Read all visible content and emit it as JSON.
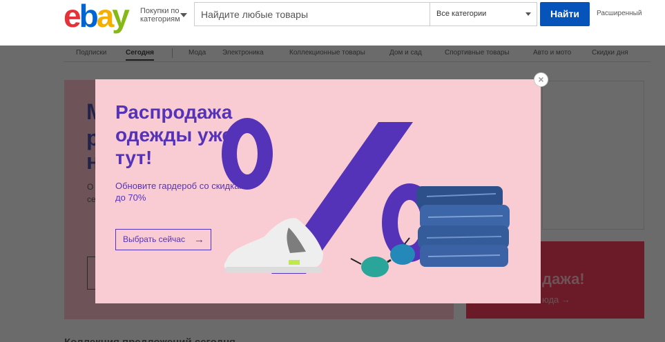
{
  "header": {
    "logo_text": "ebay",
    "shop_by_line1": "Покупки по",
    "shop_by_line2": "категориям",
    "search_placeholder": "Найдите любые товары",
    "category_value": "Все категории",
    "search_button": "Найти",
    "advanced_link": "Расширенный"
  },
  "nav": {
    "items": [
      "Подписки",
      "Сегодня",
      "Мода",
      "Электроника",
      "Коллекционные товары",
      "Дом и сад",
      "Спортивные товары",
      "Авто и мото",
      "Скидки дня"
    ],
    "active": "Сегодня"
  },
  "background": {
    "left_big_letters": [
      "М",
      "р",
      "н"
    ],
    "left_small_letters": [
      "О",
      "се"
    ],
    "right_banner_line1": "дажа!",
    "right_banner_line2": "юда →",
    "bottom_title": "Коллекция предложений сегодня"
  },
  "modal": {
    "title": "Распродажа одежды уже тут!",
    "subtitle": "Обновите гардероб со скидками до 70%",
    "cta_label": "Выбрать сейчас",
    "cta_arrow": "→",
    "close_symbol": "×",
    "accent_color": "#5533b8",
    "background_color": "#f9ccd3"
  },
  "colors": {
    "search_button": "#0654ba",
    "overlay": "#6b6b6b"
  }
}
